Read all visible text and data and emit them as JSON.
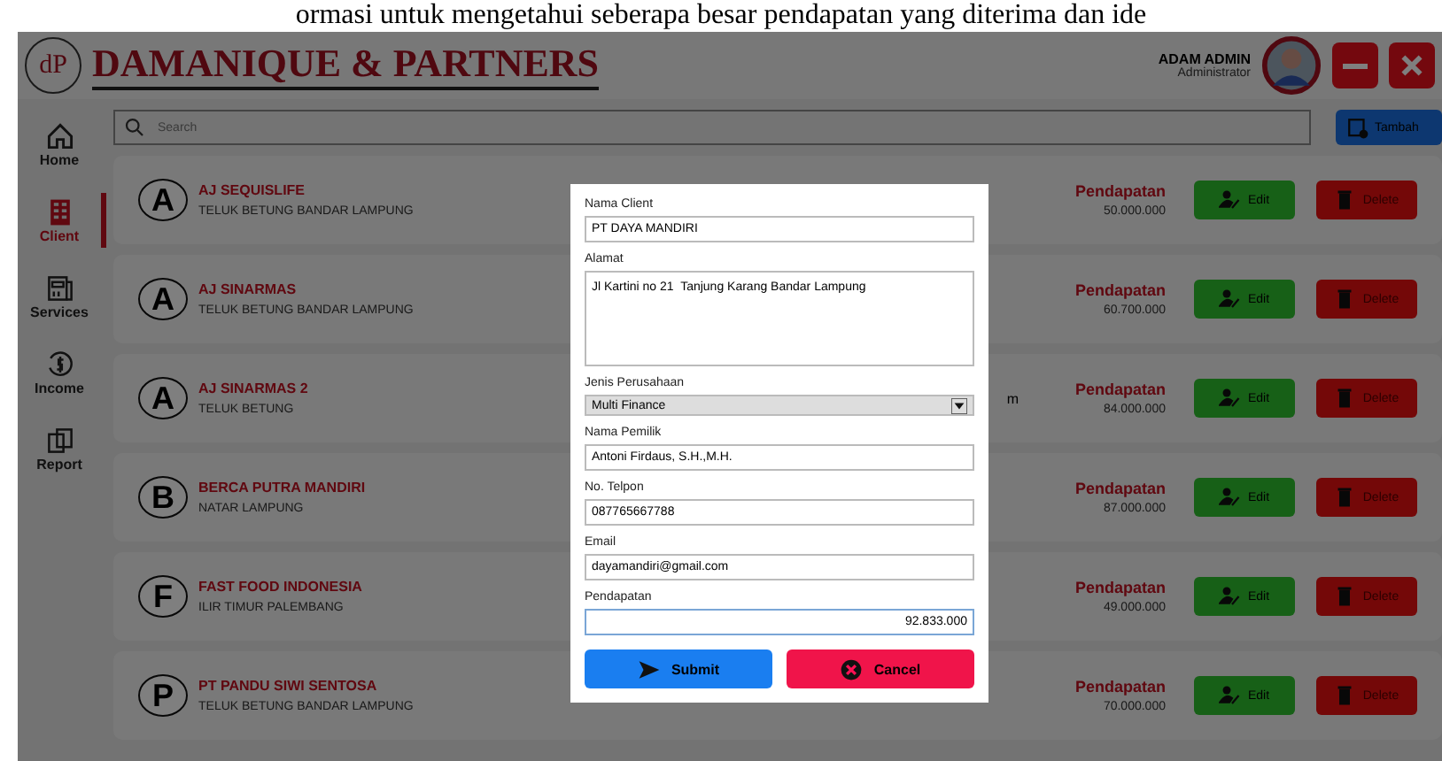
{
  "document_text": "ormasi untuk mengetahui seberapa besar pendapatan yang diterima dan ide",
  "header": {
    "logo": "dP",
    "title": "DAMANIQUE & PARTNERS",
    "user_name": "ADAM ADMIN",
    "user_role": "Administrator"
  },
  "sidebar": {
    "items": [
      {
        "label": "Home",
        "selected": false
      },
      {
        "label": "Client",
        "selected": true
      },
      {
        "label": "Services",
        "selected": false
      },
      {
        "label": "Income",
        "selected": false
      },
      {
        "label": "Report",
        "selected": false
      }
    ]
  },
  "search": {
    "placeholder": "Search"
  },
  "add_button": "Tambah",
  "clients": [
    {
      "initial": "A",
      "name": "AJ SEQUISLIFE",
      "address": "TELUK BETUNG BANDAR LAMPUNG",
      "income_label": "Pendapatan",
      "income": "50.000.000",
      "edit": "Edit",
      "delete": "Delete"
    },
    {
      "initial": "A",
      "name": "AJ SINARMAS",
      "address": "TELUK BETUNG BANDAR LAMPUNG",
      "income_label": "Pendapatan",
      "income": "60.700.000",
      "edit": "Edit",
      "delete": "Delete"
    },
    {
      "initial": "A",
      "name": "AJ SINARMAS 2",
      "address": "TELUK BETUNG",
      "income_label": "Pendapatan",
      "income": "84.000.000",
      "edit": "Edit",
      "delete": "Delete",
      "covered_text": "m"
    },
    {
      "initial": "B",
      "name": "BERCA PUTRA MANDIRI",
      "address": "NATAR LAMPUNG",
      "income_label": "Pendapatan",
      "income": "87.000.000",
      "edit": "Edit",
      "delete": "Delete"
    },
    {
      "initial": "F",
      "name": "FAST FOOD INDONESIA",
      "address": "ILIR TIMUR PALEMBANG",
      "income_label": "Pendapatan",
      "income": "49.000.000",
      "edit": "Edit",
      "delete": "Delete"
    },
    {
      "initial": "P",
      "name": "PT PANDU SIWI SENTOSA",
      "address": "TELUK BETUNG BANDAR LAMPUNG",
      "income_label": "Pendapatan",
      "income": "70.000.000",
      "edit": "Edit",
      "delete": "Delete"
    }
  ],
  "dialog": {
    "fields": [
      {
        "kind": "text",
        "label": "Nama Client",
        "value": "PT DAYA MANDIRI"
      },
      {
        "kind": "textarea",
        "label": "Alamat",
        "value": "Jl Kartini no 21  Tanjung Karang Bandar Lampung"
      },
      {
        "kind": "select",
        "label": "Jenis Perusahaan",
        "value": "Multi Finance"
      },
      {
        "kind": "text",
        "label": "Nama Pemilik",
        "value": "Antoni Firdaus, S.H.,M.H."
      },
      {
        "kind": "text",
        "label": "No. Telpon",
        "value": "087765667788"
      },
      {
        "kind": "text",
        "label": "Email",
        "value": "dayamandiri@gmail.com"
      },
      {
        "kind": "number",
        "label": "Pendapatan",
        "value": "92.833.000"
      }
    ],
    "submit": "Submit",
    "cancel": "Cancel"
  }
}
